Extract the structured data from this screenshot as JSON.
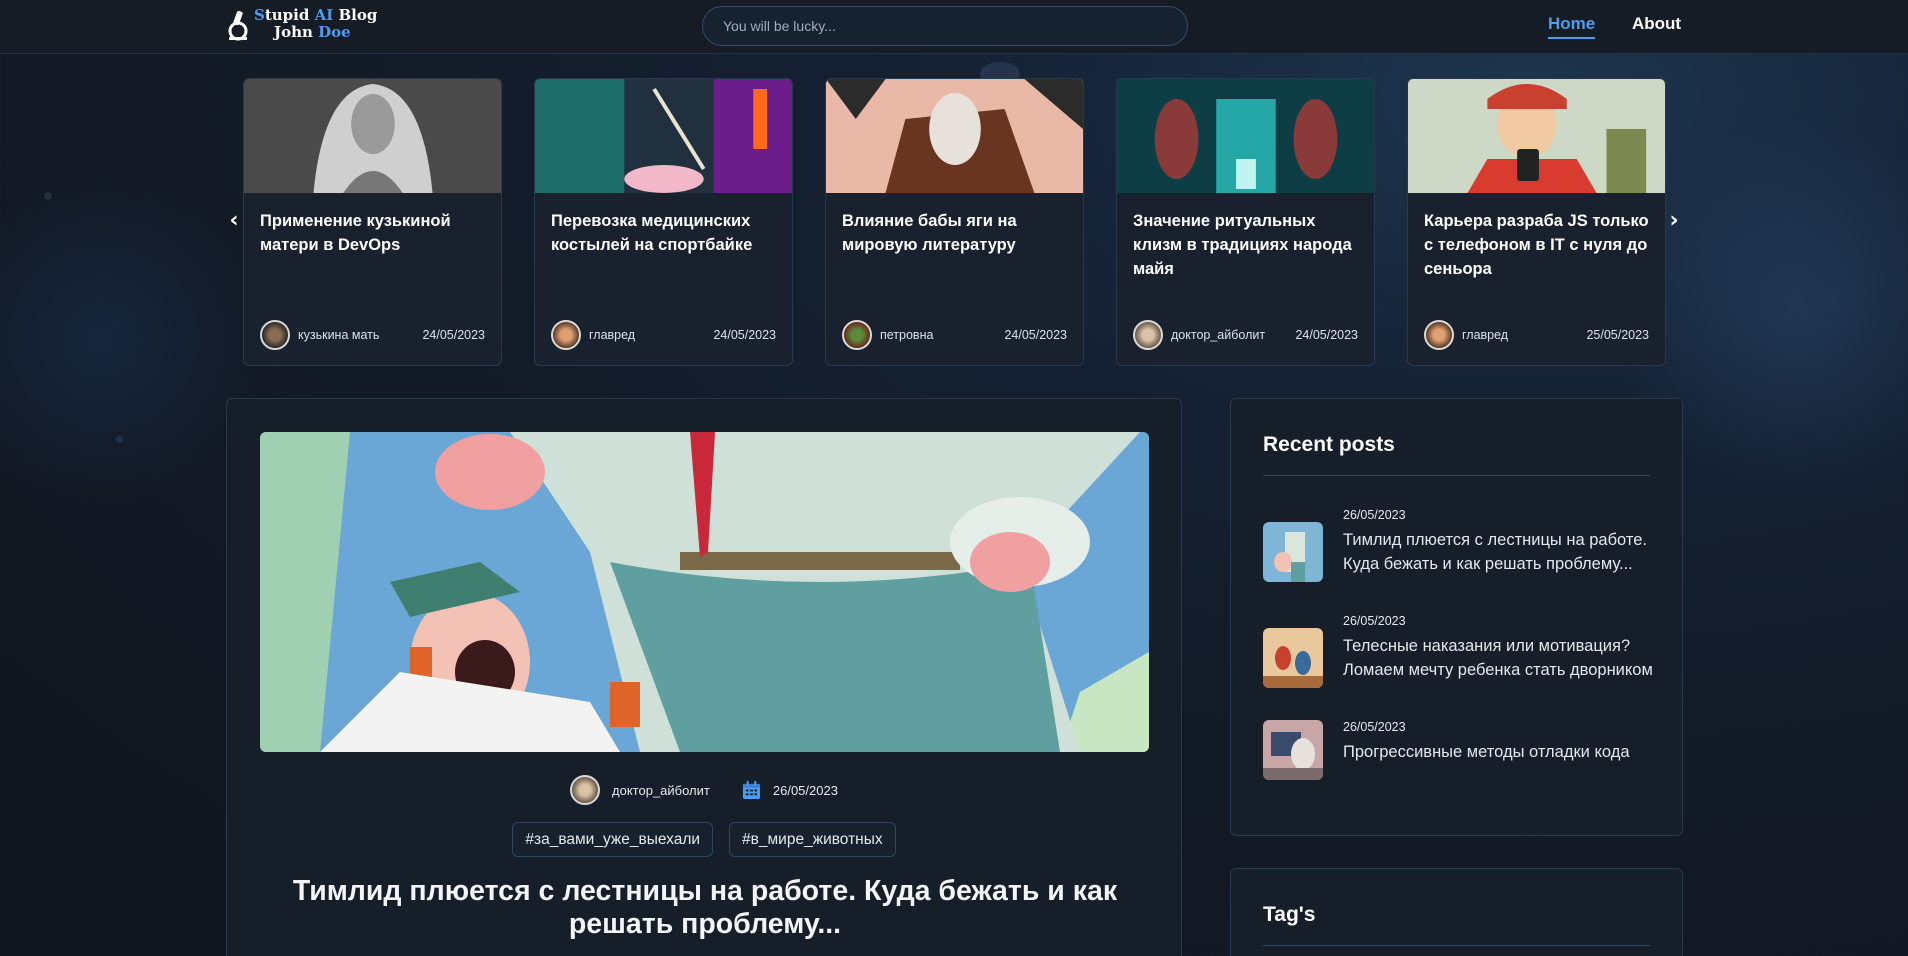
{
  "header": {
    "logo_line1_accent": "S",
    "logo_line1_a": "tupid ",
    "logo_line1_b": "AI",
    "logo_line1_c": " Blog",
    "logo_line2_a": "John ",
    "logo_line2_b": "Doe",
    "search_placeholder": "You will be lucky...",
    "nav": {
      "home": "Home",
      "about": "About"
    }
  },
  "carousel": {
    "prev_icon": "chevron-left-icon",
    "next_icon": "chevron-right-icon",
    "cards": [
      {
        "title": "Применение кузькиной матери в DevOps",
        "author": "кузькина мать",
        "date": "24/05/2023"
      },
      {
        "title": "Перевозка медицинских костылей на спортбайке",
        "author": "главред",
        "date": "24/05/2023"
      },
      {
        "title": "Влияние бабы яги на мировую литературу",
        "author": "петровна",
        "date": "24/05/2023"
      },
      {
        "title": "Значение ритуальных клизм в традициях народа майя",
        "author": "доктор_айболит",
        "date": "24/05/2023"
      },
      {
        "title": "Карьера разраба JS только с телефоном в IT с нуля до сеньора",
        "author": "главред",
        "date": "25/05/2023"
      }
    ]
  },
  "post": {
    "author": "доктор_айболит",
    "date": "26/05/2023",
    "tags": [
      "#за_вами_уже_выехали",
      "#в_мире_животных"
    ],
    "title": "Тимлид плюется с лестницы на работе. Куда бежать и как решать проблему..."
  },
  "sidebar": {
    "recent_title": "Recent posts",
    "recent": [
      {
        "date": "26/05/2023",
        "title": "Тимлид плюется с лестницы на работе. Куда бежать и как решать проблему..."
      },
      {
        "date": "26/05/2023",
        "title": "Телесные наказания или мотивация? Ломаем мечту ребенка стать дворником"
      },
      {
        "date": "26/05/2023",
        "title": "Прогрессивные методы отладки кода"
      }
    ],
    "tags_title": "Tag's"
  },
  "colors": {
    "accent": "#4d9cf0",
    "background": "#121a26",
    "card_background": "#18212d",
    "border": "#28394d"
  }
}
